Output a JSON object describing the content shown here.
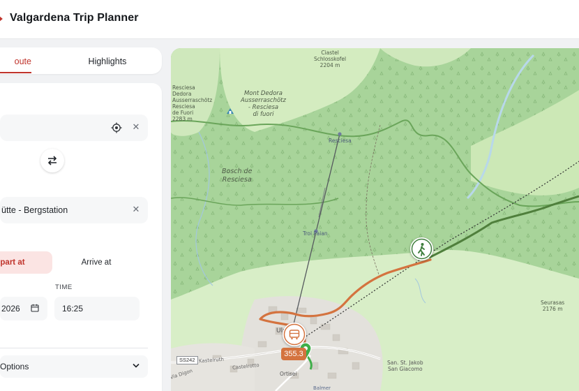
{
  "app": {
    "title": "Valgardena Trip Planner"
  },
  "tabs": [
    {
      "label": "Route",
      "visible_label": "oute",
      "active": true
    },
    {
      "label": "Highlights",
      "active": false
    }
  ],
  "form": {
    "from": {
      "value": ""
    },
    "to": {
      "value": "ütte - Bergstation"
    },
    "mode": {
      "depart_label": "epart at",
      "arrive_label": "Arrive at",
      "selected": "depart"
    },
    "time_label": "TIME",
    "date_value": "2026",
    "time_value": "16:25",
    "options_label": "Options"
  },
  "map": {
    "labels": {
      "ciastel": [
        "Ciastel",
        "Schlosskofel",
        "2204 m"
      ],
      "resciesa_top": [
        "Resciesa",
        "Dedora",
        "Ausserraschötz",
        "Resciesa",
        "de Fuori",
        "2283 m"
      ],
      "mont_dedora": [
        "Mont Dedora",
        "Ausserraschötz",
        "- Resciesa",
        "di fuori"
      ],
      "bosch": [
        "Bosch de",
        "Resciesa"
      ],
      "seurasas": [
        "Seurasas",
        "2176 m"
      ],
      "ulric": "Ulri",
      "ortisei": "Ortisei",
      "st_jakob": [
        "San. St. Jakob",
        "San Giacomo"
      ],
      "balmer": "Balmer",
      "kastelruth": "Kastelruth",
      "castelrotto": "Castelrotto",
      "via_digon": "Via Digon"
    },
    "stops": {
      "resciesa": "Resciesa",
      "troi_paian": "Troi Paian"
    },
    "road_shield": "SS242",
    "price_badge": "355.3",
    "colors": {
      "route": "#d4733f",
      "hiking": "#4f7f3c",
      "accent": "#c0342c"
    }
  }
}
